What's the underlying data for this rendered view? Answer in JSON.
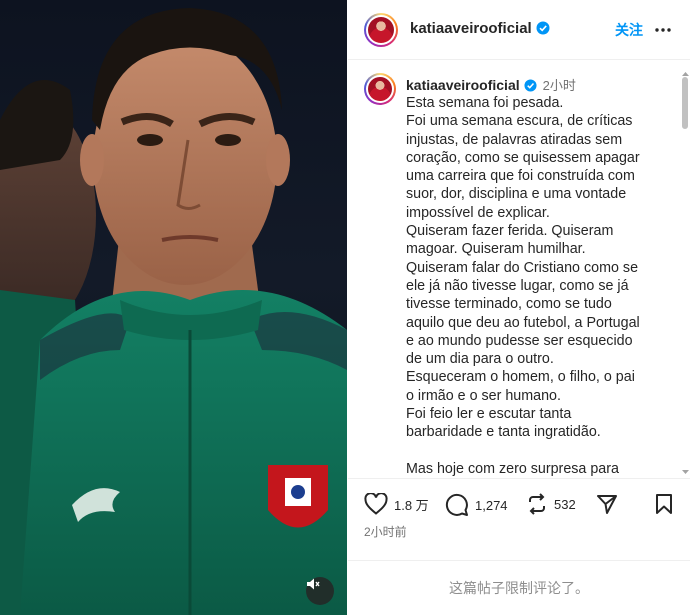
{
  "post": {
    "username": "katiaaveirooficial",
    "follow_label": "关注",
    "caption_time": "2小时",
    "caption_lines": [
      "Esta semana foi pesada.",
      "Foi uma semana escura, de críticas",
      "injustas, de palavras atiradas sem",
      "coração, como se quisessem apagar",
      "uma carreira que foi construída com",
      "suor, dor, disciplina e uma vontade",
      "impossível de explicar.",
      "Quiseram fazer ferida. Quiseram",
      "magoar. Quiseram humilhar.",
      "Quiseram falar do Cristiano como se",
      "ele já não tivesse lugar, como se já",
      "tivesse terminado, como se tudo",
      "aquilo que deu ao futebol, a Portugal",
      "e ao mundo pudesse ser esquecido",
      "de um dia para o outro.",
      "Esqueceram o homem, o filho, o pai",
      "o irmão e o ser humano.",
      "Foi feio ler e escutar tanta",
      "barbaridade e tanta ingratidão.",
      "",
      "Mas hoje com zero surpresa para"
    ],
    "likes": "1.8 万",
    "comments": "1,274",
    "reposts": "532",
    "posted_ago": "2小时前",
    "comments_disabled": "这篇帖子限制评论了。"
  },
  "icons": {
    "verified": "verified-badge-icon",
    "more": "more-horizontal-icon",
    "like": "heart-icon",
    "comment": "comment-icon",
    "repost": "repost-icon",
    "share": "send-icon",
    "save": "bookmark-icon",
    "mute": "speaker-muted-icon"
  },
  "colors": {
    "accent": "#0095f6",
    "jersey": "#0f7a5c"
  }
}
